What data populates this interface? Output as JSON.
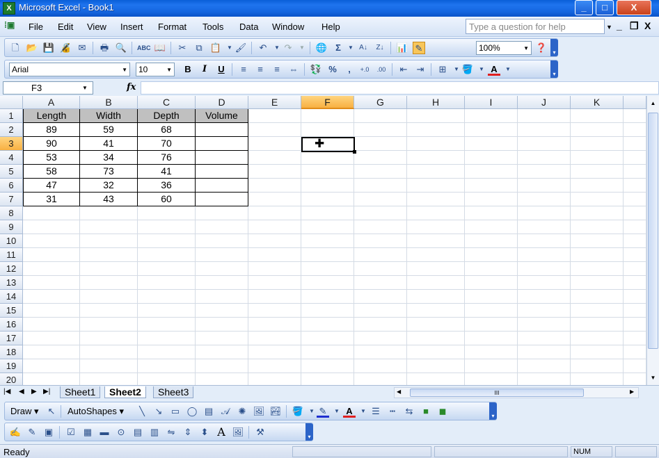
{
  "window": {
    "title": "Microsoft Excel - Book1",
    "app_icon_label": "X",
    "minimize": "_",
    "maximize": "□",
    "close": "X"
  },
  "menu": {
    "items": [
      "File",
      "Edit",
      "View",
      "Insert",
      "Format",
      "Tools",
      "Data",
      "Window",
      "Help"
    ],
    "help_placeholder": "Type a question for help",
    "doc_minimize": "_",
    "doc_restore": "❐",
    "doc_close": "X"
  },
  "toolbar_standard": {
    "zoom": "100%",
    "sum_glyph": "Σ"
  },
  "toolbar_format": {
    "font": "Arial",
    "size": "10",
    "bold": "B",
    "italic": "I",
    "underline": "U",
    "percent": "%",
    "comma": ",",
    "font_color_glyph": "A"
  },
  "formula_bar": {
    "name_box": "F3",
    "fx": "fx",
    "value": ""
  },
  "grid": {
    "columns": [
      "A",
      "B",
      "C",
      "D",
      "E",
      "F",
      "G",
      "H",
      "I",
      "J",
      "K"
    ],
    "rows": [
      "1",
      "2",
      "3",
      "4",
      "5",
      "6",
      "7",
      "8",
      "9",
      "10",
      "11",
      "12",
      "13",
      "14",
      "15",
      "16",
      "17",
      "18",
      "19",
      "20"
    ],
    "selected_column": "F",
    "selected_row": "3",
    "table_headers": [
      "Length",
      "Width",
      "Depth",
      "Volume"
    ],
    "table_rows": [
      [
        "89",
        "59",
        "68",
        ""
      ],
      [
        "90",
        "41",
        "70",
        ""
      ],
      [
        "53",
        "34",
        "76",
        ""
      ],
      [
        "58",
        "73",
        "41",
        ""
      ],
      [
        "47",
        "32",
        "36",
        ""
      ],
      [
        "31",
        "43",
        "60",
        ""
      ]
    ]
  },
  "sheets": {
    "tabs": [
      "Sheet1",
      "Sheet2",
      "Sheet3"
    ],
    "active": "Sheet2",
    "scroll_grip": "III"
  },
  "toolbar_drawing": {
    "draw_label": "Draw",
    "autoshapes_label": "AutoShapes",
    "wordart_glyph": "A"
  },
  "status": {
    "ready": "Ready",
    "num": "NUM"
  },
  "colors": {
    "title_blue": "#0a5fd8",
    "selected_header": "#f8b042",
    "table_header_fill": "#c0c0c0"
  }
}
